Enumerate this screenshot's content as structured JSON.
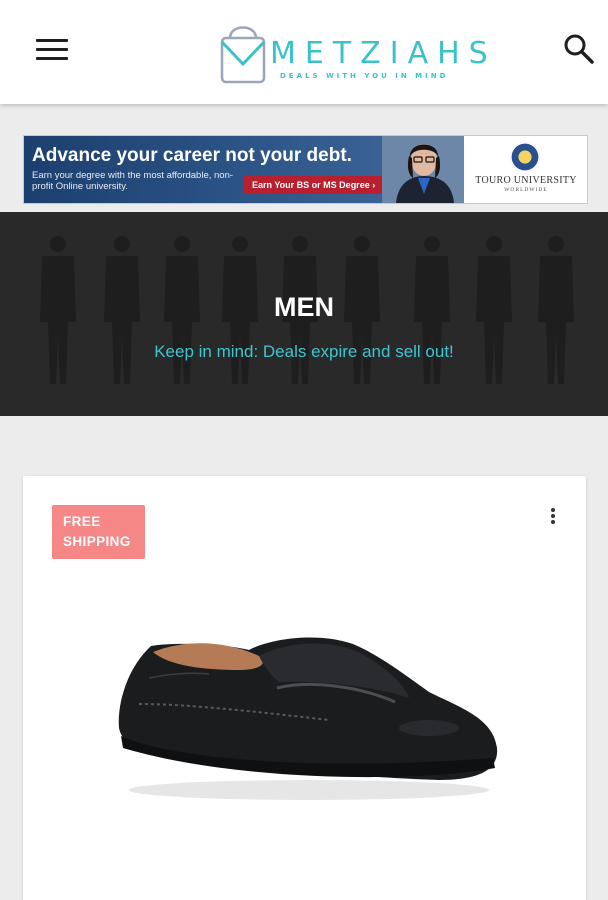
{
  "header": {
    "logo_text": "METZIAHS",
    "logo_tagline": "DEALS WITH YOU IN MIND",
    "menu_icon": "hamburger-menu-icon",
    "search_icon": "search-icon",
    "brand_color": "#39c3c9"
  },
  "ad": {
    "headline": "Advance your career not your debt.",
    "subtext": "Earn your degree with the most affordable, non-profit Online university.",
    "cta": "Earn Your BS or MS Degree ›",
    "university_name": "TOURO UNIVERSITY",
    "university_sub": "WORLDWIDE"
  },
  "hero": {
    "title": "MEN",
    "tagline": "Keep in mind: Deals expire and sell out!",
    "tagline_color": "#3fc5d2"
  },
  "product_card": {
    "badge": [
      "FREE",
      "SHIPPING"
    ],
    "badge_color": "#f58787",
    "options_icon": "more-vertical-icon",
    "image": "black-leather-loafer"
  }
}
